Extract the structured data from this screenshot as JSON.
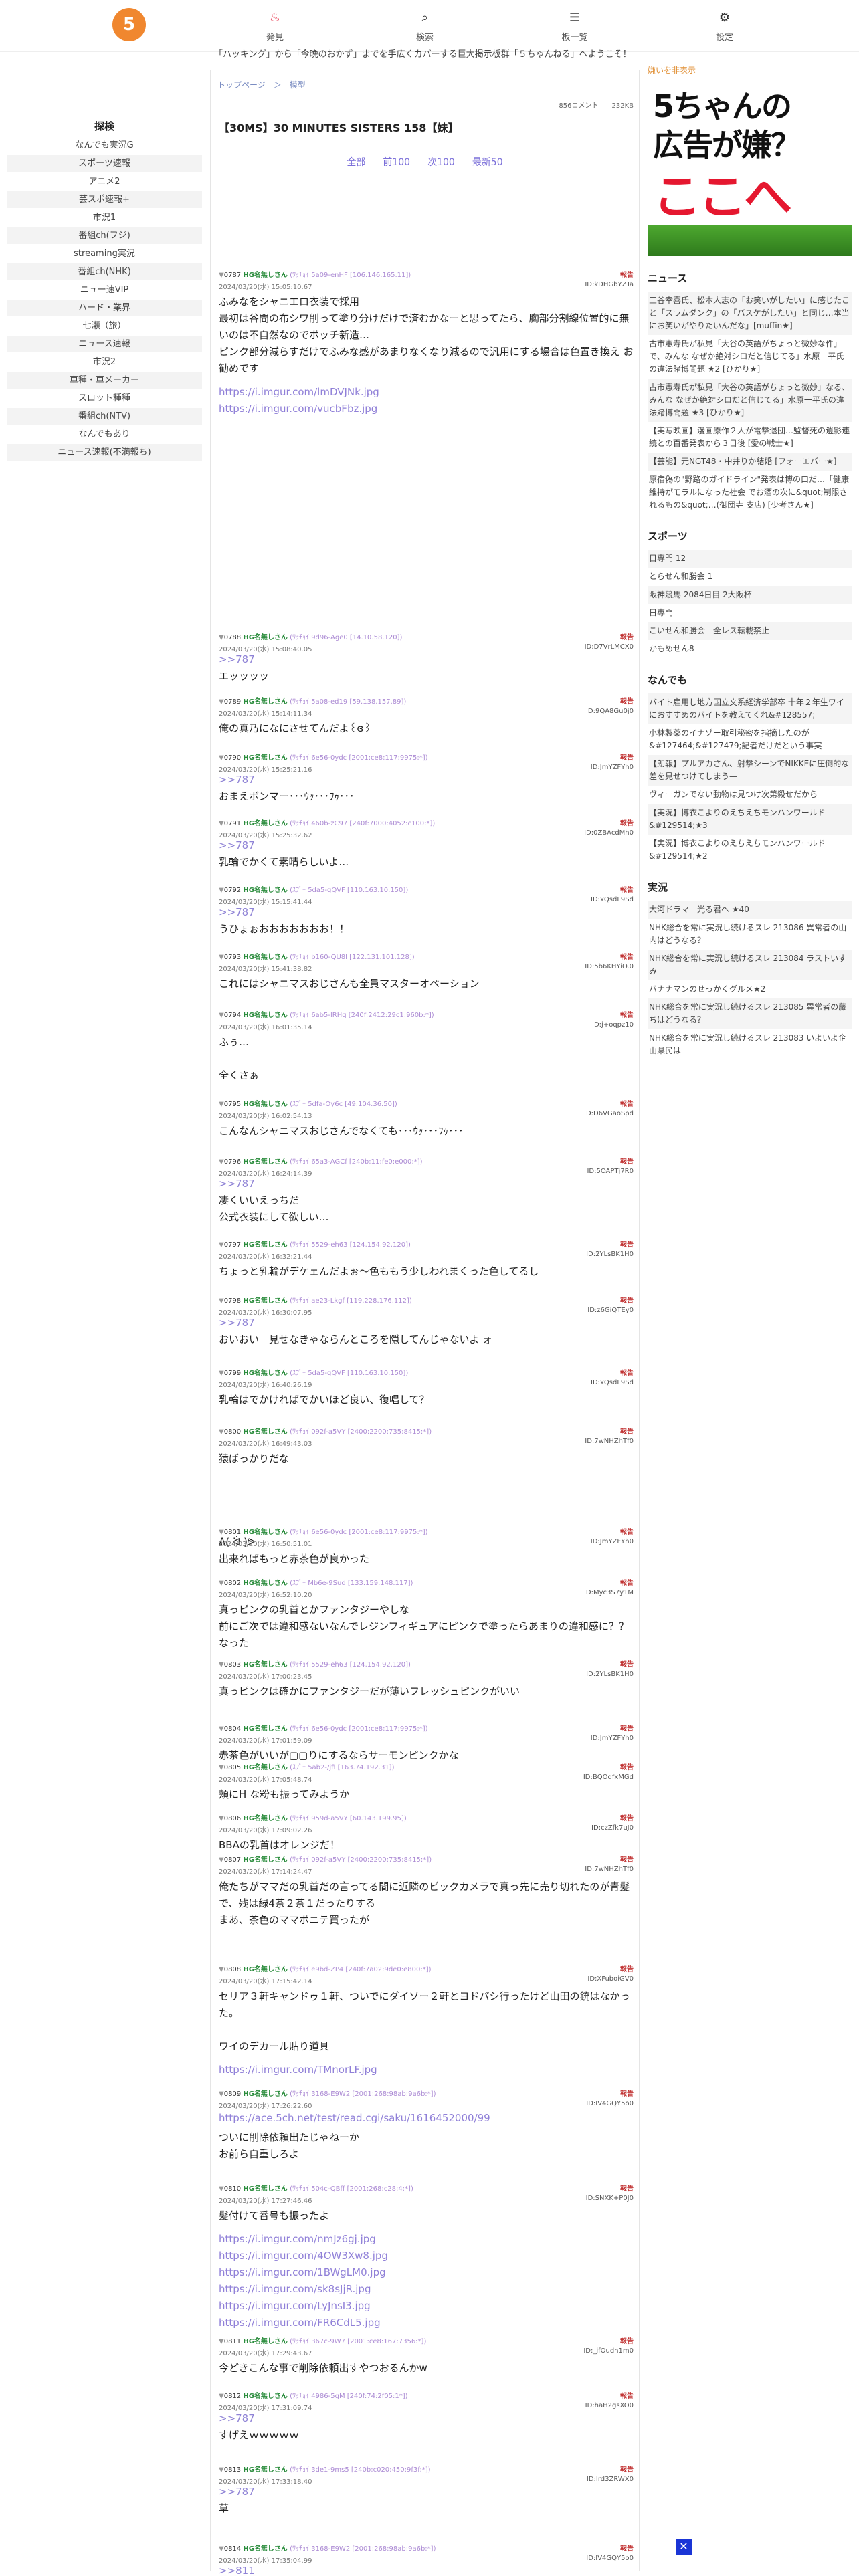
{
  "header": {
    "logo": "5",
    "nav": [
      {
        "label": "発見",
        "icon": "fire-icon"
      },
      {
        "label": "検索",
        "icon": "magnifier-icon"
      },
      {
        "label": "板一覧",
        "icon": "list-icon"
      },
      {
        "label": "設定",
        "icon": "gear-icon"
      }
    ],
    "ticker": "「ハッキング」から「今晩のおかず」までを手広くカバーする巨大掲示板群「５ちゃんねる」へようこそ！"
  },
  "left": {
    "heading": "探検",
    "items": [
      "なんでも実況G",
      "スポーツ速報",
      "アニメ2",
      "芸スポ速報+",
      "市況1",
      "番組ch(フジ)",
      "streaming実況",
      "番組ch(NHK)",
      "ニュー速VIP",
      "ハード・業界",
      "七瀬（旅）",
      "ニュース速報",
      "市況2",
      "車種・車メーカー",
      "スロット種種",
      "番組ch(NTV)",
      "なんでもあり",
      "ニュース速報(不満報ち)"
    ]
  },
  "thread": {
    "breadcrumb": "トップページ　＞　模型",
    "meta": "856コメント　　232KB",
    "title": "【30MS】30 MINUTES SISTERS 158【妹】",
    "pager": [
      "全部",
      "前100",
      "次100",
      "最新50"
    ]
  },
  "posts": [
    {
      "no": "0787",
      "name": "HG名無しさん",
      "trip": "(ﾜｯﾁｮｲ 5a09-enHF [106.146.165.11])",
      "date": "2024/03/20(水) 15:05:10.67",
      "id": "ID:kDHGbYZTa",
      "body": "ふみなをシャニエロ衣装で採用\n最初は谷間の布シワ削って塗り分けだけで済むかなーと思ってたら、胸部分割線位置的に無いのは不自然なのでポッチ新造…\nピンク部分減らすだけでふみな感があまりなくなり減るので汎用にする場合は色置き換え お勧めです",
      "links": [
        "https://i.imgur.com/lmDVJNk.jpg",
        "https://i.imgur.com/vucbFbz.jpg"
      ]
    },
    {
      "no": "0788",
      "name": "HG名無しさん",
      "trip": "(ﾜｯﾁｮｲ 9d96-Age0 [14.10.58.120])",
      "date": "2024/03/20(水) 15:08:40.05",
      "id": "ID:D7VrLMCX0",
      "anchor": ">>787",
      "body": "エッッッッ"
    },
    {
      "no": "0789",
      "name": "HG名無しさん",
      "trip": "(ﾜｯﾁｮｲ 5a08-ed19 [59.138.157.89])",
      "date": "2024/03/20(水) 15:14:11.34",
      "id": "ID:9QA8Gu0j0",
      "body": "俺の真乃になにさせてんだよ꒰ɞ꒱"
    },
    {
      "no": "0790",
      "name": "HG名無しさん",
      "trip": "(ﾜｯﾁｮｲ 6e56-0ydc [2001:ce8:117:9975:*])",
      "date": "2024/03/20(水) 15:25:21.16",
      "id": "ID:JmYZFYh0",
      "anchor": ">>787",
      "body": "おまえボンマー･･･ｳｯ･･･ﾌｩ･･･"
    },
    {
      "no": "0791",
      "name": "HG名無しさん",
      "trip": "(ﾜｯﾁｮｲ 460b-zC97 [240f:7000:4052:c100:*])",
      "date": "2024/03/20(水) 15:25:32.62",
      "id": "ID:0ZBAcdMh0",
      "anchor": ">>787",
      "body": "乳輪でかくて素晴らしいよ…"
    },
    {
      "no": "0792",
      "name": "HG名無しさん",
      "trip": "(ｽﾌﾟｰ 5da5-gQVF [110.163.10.150])",
      "date": "2024/03/20(水) 15:15:41.44",
      "id": "ID:xQsdL9Sd",
      "anchor": ">>787",
      "body": "うひょぉおおおおおおお！！"
    },
    {
      "no": "0793",
      "name": "HG名無しさん",
      "trip": "(ﾜｯﾁｮｲ b160-QU8l [122.131.101.128])",
      "date": "2024/03/20(水) 15:41:38.82",
      "id": "ID:5b6KHYiO.0",
      "body": "これにはシャニマスおじさんも全員マスターオベーション"
    },
    {
      "no": "0794",
      "name": "HG名無しさん",
      "trip": "(ﾜｯﾁｮｲ 6ab5-lRHq [240f:2412:29c1:960b:*])",
      "date": "2024/03/20(水) 16:01:35.14",
      "id": "ID:j+oqpz10",
      "body": "ふぅ…\n\n全くさぁ"
    },
    {
      "no": "0795",
      "name": "HG名無しさん",
      "trip": "(ｽﾌﾟｰ 5dfa-Oy6c [49.104.36.50])",
      "date": "2024/03/20(水) 16:02:54.13",
      "id": "ID:D6VGaoSpd",
      "body": "こんなんシャニマスおじさんでなくても･･･ｳｯ･･･ﾌｩ･･･"
    },
    {
      "no": "0796",
      "name": "HG名無しさん",
      "trip": "(ﾜｯﾁｮｲ 65a3-AGCf [240b:11:fe0:e000:*])",
      "date": "2024/03/20(水) 16:24:14.39",
      "id": "ID:5OAPTj7R0",
      "anchor": ">>787",
      "body": "凄くいいえっちだ\n公式衣装にして欲しい…"
    },
    {
      "no": "0797",
      "name": "HG名無しさん",
      "trip": "(ﾜｯﾁｮｲ 5529-eh63 [124.154.92.120])",
      "date": "2024/03/20(水) 16:32:21.44",
      "id": "ID:2YLsBK1H0",
      "body": "ちょっと乳輪がデケェんだよぉ〜色ももう少しわれまくった色してるし"
    },
    {
      "no": "0798",
      "name": "HG名無しさん",
      "trip": "(ﾜｯﾁｮｲ ae23-Lkgf [119.228.176.112])",
      "date": "2024/03/20(水) 16:30:07.95",
      "id": "ID:z6GiQTEy0",
      "anchor": ">>787",
      "body": "おいおい　見せなきゃならんところを隠してんじゃないよ ォ"
    },
    {
      "no": "0799",
      "name": "HG名無しさん",
      "trip": "(ｽﾌﾟｰ 5da5-gQVF [110.163.10.150])",
      "date": "2024/03/20(水) 16:40:26.19",
      "id": "ID:xQsdL9Sd",
      "body": "乳輪はでかければでかいほど良い、復唱して？"
    },
    {
      "no": "0800",
      "name": "HG名無しさん",
      "trip": "(ﾜｯﾁｮｲ 092f-a5VY [2400:2200:735:8415:*])",
      "date": "2024/03/20(水) 16:49:43.03",
      "id": "ID:7wNHZhTf0",
      "body": "猿ばっかりだな\n\n\n\n\nᕕ( ᐛ )ᕗ"
    },
    {
      "no": "0801",
      "name": "HG名無しさん",
      "trip": "(ﾜｯﾁｮｲ 6e56-0ydc [2001:ce8:117:9975:*])",
      "date": "2024/03/20(水) 16:50:51.01",
      "id": "ID:JmYZFYh0",
      "body": "出来ればもっと赤茶色が良かった"
    },
    {
      "no": "0802",
      "name": "HG名無しさん",
      "trip": "(ｽﾌﾟｰ Mb6e-9Sud [133.159.148.117])",
      "date": "2024/03/20(水) 16:52:10.20",
      "id": "ID:Myc3S7y1M",
      "body": "真っピンクの乳首とかファンタジーやしな\n前にご次では違和感ないなんでレジンフィギュアにピンクで塗ったらあまりの違和感に？？なった"
    },
    {
      "no": "0803",
      "name": "HG名無しさん",
      "trip": "(ﾜｯﾁｮｲ 5529-eh63 [124.154.92.120])",
      "date": "2024/03/20(水) 17:00:23.45",
      "id": "ID:2YLsBK1H0",
      "body": "真っピンクは確かにファンタジーだが薄いフレッシュピンクがいい"
    },
    {
      "no": "0804",
      "name": "HG名無しさん",
      "trip": "(ﾜｯﾁｮｲ 6e56-0ydc [2001:ce8:117:9975:*])",
      "date": "2024/03/20(水) 17:01:59.09",
      "id": "ID:JmYZFYh0",
      "body": "赤茶色がいいが▢▢りにするならサーモンピンクかな"
    },
    {
      "no": "0805",
      "name": "HG名無しさん",
      "trip": "(ｽﾌﾟｰ 5ab2-/jfi [163.74.192.31])",
      "date": "2024/03/20(水) 17:05:48.74",
      "id": "ID:BQOdfxMGd",
      "body": "頬にH な粉も振ってみようか"
    },
    {
      "no": "0806",
      "name": "HG名無しさん",
      "trip": "(ﾜｯﾁｮｲ 959d-a5VY [60.143.199.95])",
      "date": "2024/03/20(水) 17:09:02.26",
      "id": "ID:czZfk7uJ0",
      "body": "BBAの乳首はオレンジだ！"
    },
    {
      "no": "0807",
      "name": "HG名無しさん",
      "trip": "(ﾜｯﾁｮｲ 092f-a5VY [2400:2200:735:8415:*])",
      "date": "2024/03/20(水) 17:14:24.47",
      "id": "ID:7wNHZhTf0",
      "body": "俺たちがママだの乳首だの言ってる間に近隣のビックカメラで真っ先に売り切れたのが青髪で、残は緑4茶２茶１だったりする\nまあ、茶色のママポニテ買ったが"
    },
    {
      "no": "0808",
      "name": "HG名無しさん",
      "trip": "(ﾜｯﾁｮｲ e9bd-ZP4 [240f:7a02:9de0:e800:*])",
      "date": "2024/03/20(水) 17:15:42.14",
      "id": "ID:XFuboiGV0",
      "body": "セリア３軒キャンドゥ１軒、ついでにダイソー２軒とヨドバシ行ったけど山田の銃はなかった。\n\nワイのデカール貼り道具",
      "links": [
        "https://i.imgur.com/TMnorLF.jpg"
      ]
    },
    {
      "no": "0809",
      "name": "HG名無しさん",
      "trip": "(ﾜｯﾁｮｲ 3168-E9W2 [2001:268:98ab:9a6b:*])",
      "date": "2024/03/20(水) 17:26:22.60",
      "id": "ID:IV4GQY5o0",
      "linksTop": [
        "https://ace.5ch.net/test/read.cgi/saku/1616452000/99"
      ],
      "body": "ついに削除依頼出たじゃねーか\nお前ら自重しろよ"
    },
    {
      "no": "0810",
      "name": "HG名無しさん",
      "trip": "(ﾜｯﾁｮｲ 504c-QBff [2001:268:c28:4:*])",
      "date": "2024/03/20(水) 17:27:46.46",
      "id": "ID:SNXK+P0J0",
      "body": "髪付けて番号も振ったよ",
      "links": [
        "https://i.imgur.com/nmJz6gj.jpg",
        "https://i.imgur.com/4OW3Xw8.jpg",
        "https://i.imgur.com/1BWgLM0.jpg",
        "https://i.imgur.com/sk8sJjR.jpg",
        "https://i.imgur.com/LyJnsI3.jpg",
        "https://i.imgur.com/FR6CdL5.jpg"
      ]
    },
    {
      "no": "0811",
      "name": "HG名無しさん",
      "trip": "(ﾜｯﾁｮｲ 367c-9W7 [2001:ce8:167:7356:*])",
      "date": "2024/03/20(水) 17:29:43.67",
      "id": "ID:_jfOudn1m0",
      "body": "今どきこんな事で削除依頼出すやつおるんかw"
    },
    {
      "no": "0812",
      "name": "HG名無しさん",
      "trip": "(ﾜｯﾁｮｲ 4986-5gM [240f:74:2f05:1*])",
      "date": "2024/03/20(水) 17:31:09.74",
      "id": "ID:haH2gsXO0",
      "anchor": ">>787",
      "body": "すげえｗｗｗｗｗ"
    },
    {
      "no": "0813",
      "name": "HG名無しさん",
      "trip": "(ﾜｯﾁｮｲ 3de1-9ms5 [240b:c020:450:9f3f:*])",
      "date": "2024/03/20(水) 17:33:18.40",
      "id": "ID:Ird3ZRWX0",
      "anchor": ">>787",
      "body": "草"
    },
    {
      "no": "0814",
      "name": "HG名無しさん",
      "trip": "(ﾜｯﾁｮｲ 3168-E9W2 [2001:268:98ab:9a6b:*])",
      "date": "2024/03/20(水) 17:35:04.99",
      "id": "ID:IV4GQY5o0",
      "anchor": ">>811"
    }
  ],
  "right": {
    "adhead": "嫌いを非表示",
    "ad": {
      "l1": "5ちゃんの",
      "l2": "広告が嫌？",
      "l3": "ここへ"
    },
    "sections": [
      {
        "title": "ニュース",
        "items": [
          "三谷幸喜氏、松本人志の「お笑いがしたい」に感じたこと「スラムダンク」の「バスケがしたい」と同じ…本当にお笑いがやりたいんだな」[muffin★]",
          "古市憲寿氏が私見「大谷の英語がちょっと微妙な件」で、みんな なぜか絶対シロだと信じてる」水原一平氏の違法賭博問題 ★2 [ひかり★]",
          "古市憲寿氏が私見「大谷の英語がちょっと微妙」なる、みんな なぜか絶対シロだと信じてる」水原一平氏の違法賭博問題 ★3 [ひかり★]",
          "【実写映画】漫画原作２人が電撃退団…監督死の遺影連続との百番発表から３日後 [愛の戦士★]",
          "【芸能】元NGT48・中井りか結婚 [フォーエバー★]",
          "原宿偽の\"野路のガイドライン\"発表は博の口だ…「健康維持がモラルになった社会 でお酒の次に&quot;制限されるもの&quot;…(御団寺 支店) [少考さん★]"
        ]
      },
      {
        "title": "スポーツ",
        "items": [
          "日専門 12",
          "とらせん和勝会 1",
          "阪神競馬 2084日目 2大阪杯",
          "日専門",
          "こいせん和勝会　全レス転載禁止",
          "かもめせん8"
        ]
      },
      {
        "title": "なんでも",
        "items": [
          "バイト雇用し地方国立文系経済学部卒 十年２年生ワイにおすすめのバイトを教えてくれ&#128557;",
          "小林製薬のイナゾー取引秘密を指摘したのが&#127464;&#127479;記者だけだという事実",
          "【朗報】プルアカさん、射撃シーンでNIKKEに圧倒的な差を見せつけてしまう—",
          "ヴィーガンでない動物は見つけ次第殺せだから",
          "【実況】博衣こよりのえちえちモンハンワールド&#129514;★3",
          "【実況】博衣こよりのえちえちモンハンワールド&#129514;★2"
        ]
      },
      {
        "title": "実況",
        "items": [
          "大河ドラマ　光る君へ ★40",
          "NHK総合を常に実況し続けるスレ 213086 異常者の山内はどうなる？",
          "NHK総合を常に実況し続けるスレ 213084 ラストいすみ",
          "バナナマンのせっかくグルメ★2",
          "NHK総合を常に実況し続けるスレ 213085 異常者の藤ちはどうなる？",
          "NHK総合を常に実況し続けるスレ 213083 いよいよ企山県民は"
        ]
      }
    ]
  }
}
